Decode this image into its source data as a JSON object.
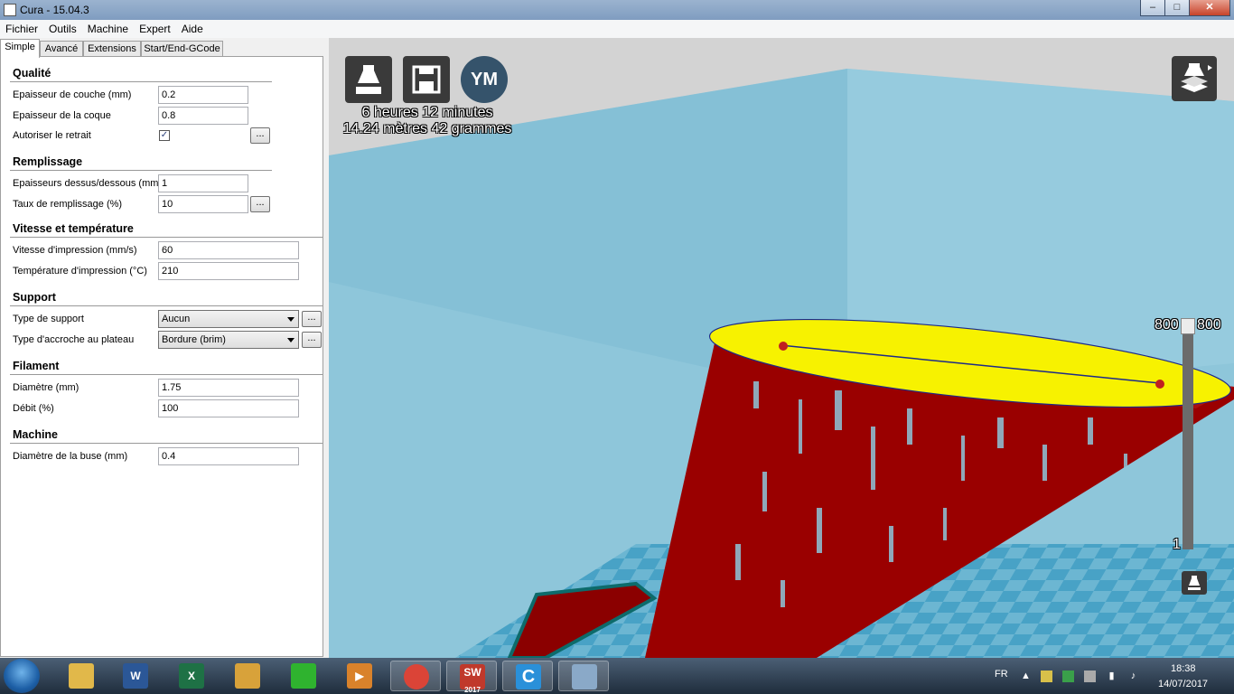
{
  "window": {
    "title": "Cura - 15.04.3",
    "minimize": "–",
    "maximize": "□",
    "close": "✕"
  },
  "menu": [
    "Fichier",
    "Outils",
    "Machine",
    "Expert",
    "Aide"
  ],
  "tabs": [
    "Simple",
    "Avancé",
    "Extensions",
    "Start/End-GCode"
  ],
  "sections": {
    "quality": "Qualité",
    "fill": "Remplissage",
    "speed": "Vitesse et température",
    "support": "Support",
    "filament": "Filament",
    "machine": "Machine"
  },
  "fields": {
    "layer_height": {
      "label": "Epaisseur de couche (mm)",
      "value": "0.2"
    },
    "shell": {
      "label": "Epaisseur de la coque",
      "value": "0.8"
    },
    "retraction": {
      "label": "Autoriser le retrait",
      "checked": "✓"
    },
    "top_bottom": {
      "label": "Epaisseurs dessus/dessous (mm)",
      "value": "1"
    },
    "infill": {
      "label": "Taux de remplissage (%)",
      "value": "10"
    },
    "print_speed": {
      "label": "Vitesse d'impression (mm/s)",
      "value": "60"
    },
    "print_temp": {
      "label": "Température d'impression (°C)",
      "value": "210"
    },
    "support_type": {
      "label": "Type de support",
      "value": "Aucun"
    },
    "adhesion": {
      "label": "Type d'accroche au plateau",
      "value": "Bordure (brim)"
    },
    "diameter": {
      "label": "Diamètre (mm)",
      "value": "1.75"
    },
    "flow": {
      "label": "Débit (%)",
      "value": "100"
    },
    "nozzle": {
      "label": "Diamètre de la buse (mm)",
      "value": "0.4"
    }
  },
  "more_label": "...",
  "viewport": {
    "avatar": "YM",
    "time": "6 heures 12 minutes",
    "material": "14.24 mètres 42 grammes",
    "layer_top_left": "800",
    "layer_top_right": "800",
    "layer_bottom": "1"
  },
  "taskbar": {
    "apps": [
      {
        "name": "explorer-icon",
        "color": "#e1b84a",
        "label": ""
      },
      {
        "name": "word-icon",
        "color": "#2b5797",
        "label": "W"
      },
      {
        "name": "excel-icon",
        "color": "#1e7145",
        "label": "X"
      },
      {
        "name": "outlook-icon",
        "color": "#d8a23a",
        "label": ""
      },
      {
        "name": "ultimaker-icon",
        "color": "#2fb32f",
        "label": ""
      },
      {
        "name": "media-icon",
        "color": "#d9822b",
        "label": "▶"
      },
      {
        "name": "chrome-icon",
        "color": "#db4437",
        "label": ""
      },
      {
        "name": "solidworks-icon",
        "color": "#c0392b",
        "label": "SW"
      },
      {
        "name": "cura-icon",
        "color": "#2a90d9",
        "label": "C"
      },
      {
        "name": "paint-icon",
        "color": "#8aa9c8",
        "label": ""
      }
    ],
    "sw_year": "2017",
    "lang": "FR",
    "time": "18:38",
    "date": "14/07/2017"
  }
}
